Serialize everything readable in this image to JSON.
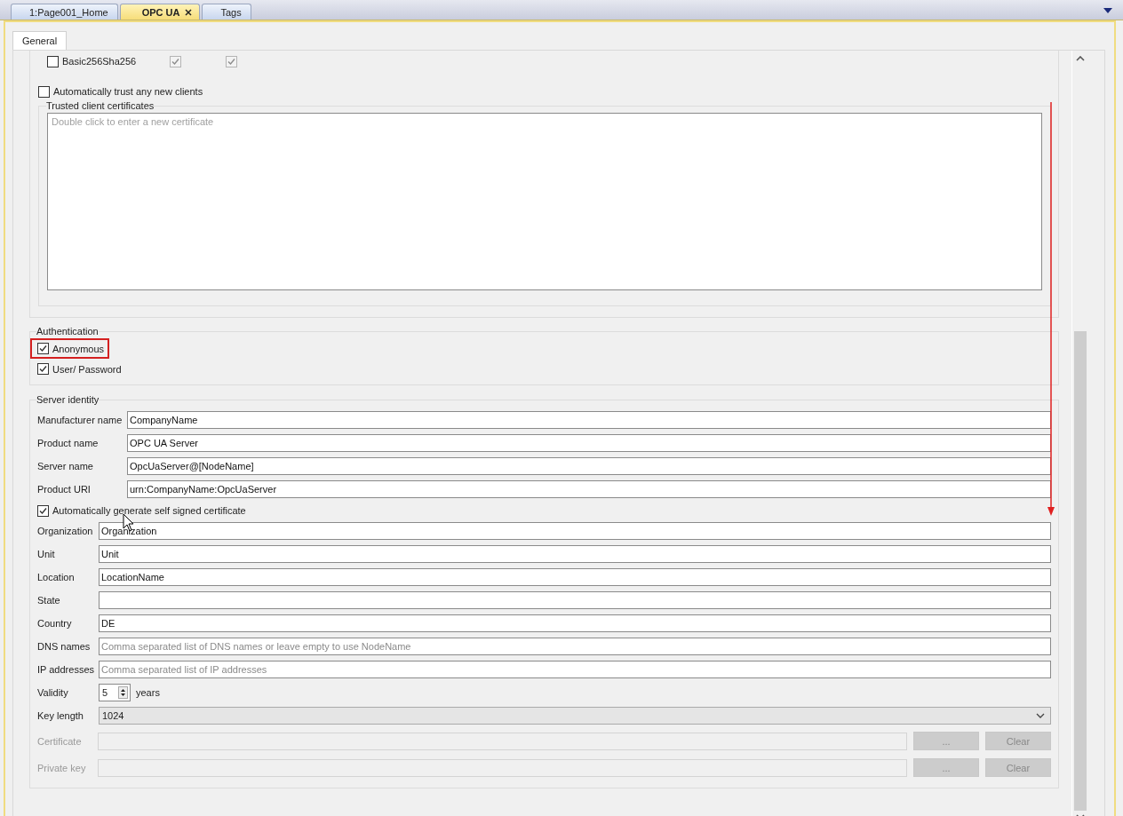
{
  "doc_tabs": [
    {
      "label": "1:Page001_Home",
      "selected": false,
      "closable": false
    },
    {
      "label": "OPC UA",
      "selected": true,
      "closable": true
    },
    {
      "label": "Tags",
      "selected": false,
      "closable": false
    }
  ],
  "panel_tabs": [
    {
      "label": "General",
      "selected": true
    }
  ],
  "security": {
    "policies": [
      {
        "label": "Basic256Sha256",
        "checked": false,
        "sign": true,
        "sign_encrypt": true
      }
    ],
    "trust_all": {
      "label": "Automatically trust any new clients",
      "checked": false
    },
    "trusted_certs": {
      "title": "Trusted client certificates",
      "placeholder": "Double click to enter a new certificate"
    }
  },
  "authentication": {
    "title": "Authentication",
    "options": [
      {
        "label": "Anonymous",
        "checked": true,
        "highlighted": true
      },
      {
        "label": "User/ Password",
        "checked": true,
        "highlighted": false
      }
    ]
  },
  "server_identity": {
    "title": "Server identity",
    "fields": [
      {
        "label": "Manufacturer name",
        "value": "CompanyName"
      },
      {
        "label": "Product name",
        "value": "OPC UA Server"
      },
      {
        "label": "Server name",
        "value": "OpcUaServer@[NodeName]"
      },
      {
        "label": "Product URI",
        "value": "urn:CompanyName:OpcUaServer"
      }
    ],
    "auto_cert": {
      "label": "Automatically generate self signed certificate",
      "checked": true
    },
    "cert_fields": [
      {
        "label": "Organization",
        "value": "Organization"
      },
      {
        "label": "Unit",
        "value": "Unit"
      },
      {
        "label": "Location",
        "value": "LocationName"
      },
      {
        "label": "State"
      },
      {
        "label": "Country",
        "value": "DE"
      },
      {
        "label": "DNS names",
        "placeholder": "Comma separated list of DNS names or leave empty to use NodeName"
      },
      {
        "label": "IP addresses",
        "placeholder": "Comma separated list of IP addresses"
      }
    ],
    "validity": {
      "label": "Validity",
      "value": "5",
      "unit": "years"
    },
    "key_length": {
      "label": "Key length",
      "value": "1024"
    },
    "files": [
      {
        "label": "Certificate",
        "disabled": true,
        "browse": "...",
        "clear": "Clear"
      },
      {
        "label": "Private key",
        "disabled": true,
        "browse": "...",
        "clear": "Clear"
      }
    ]
  }
}
